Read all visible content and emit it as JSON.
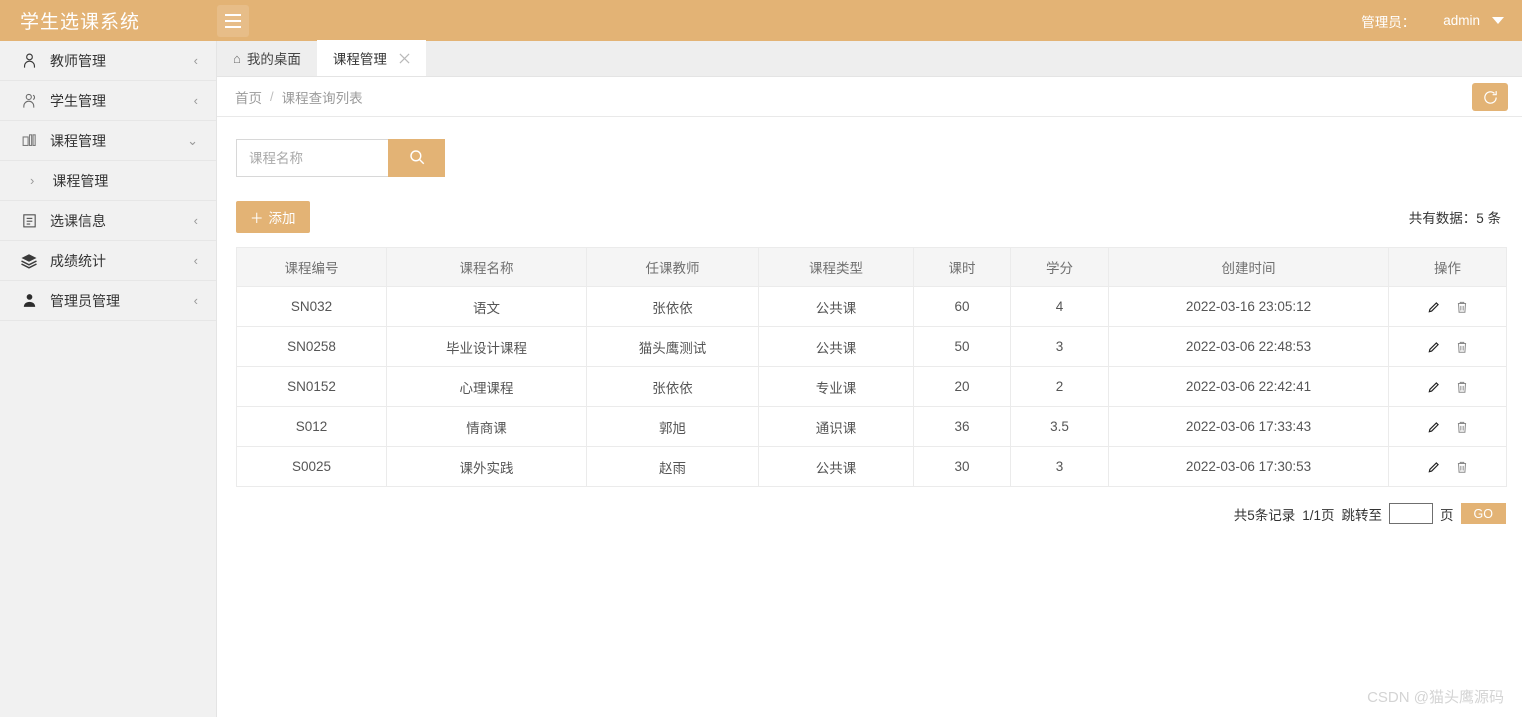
{
  "header": {
    "brand": "学生选课系统",
    "menu_toggle_icon": "hamburger-icon",
    "role_label": "管理员：",
    "username": "admin"
  },
  "sidebar": {
    "items": [
      {
        "label": "教师管理",
        "icon": "user-outline-icon",
        "arrow": "‹",
        "expanded": false
      },
      {
        "label": "学生管理",
        "icon": "users-outline-icon",
        "arrow": "‹",
        "expanded": false
      },
      {
        "label": "课程管理",
        "icon": "books-icon",
        "arrow": "⌄",
        "expanded": true
      },
      {
        "label": "选课信息",
        "icon": "clipboard-icon",
        "arrow": "‹",
        "expanded": false
      },
      {
        "label": "成绩统计",
        "icon": "layers-icon",
        "arrow": "‹",
        "expanded": false
      },
      {
        "label": "管理员管理",
        "icon": "user-solid-icon",
        "arrow": "‹",
        "expanded": false
      }
    ],
    "submenu": {
      "label": "课程管理",
      "arrow": "›"
    }
  },
  "tabs": [
    {
      "label": "我的桌面",
      "icon": "home-icon",
      "active": false,
      "closable": false
    },
    {
      "label": "课程管理",
      "icon": "",
      "active": true,
      "closable": true,
      "close_icon": "close-icon"
    }
  ],
  "breadcrumb": {
    "items": [
      "首页",
      "课程查询列表"
    ],
    "separator": "/",
    "refresh_icon": "refresh-icon"
  },
  "search": {
    "placeholder": "课程名称",
    "value": "",
    "button_icon": "search-icon"
  },
  "toolbar": {
    "add_label": "添加",
    "add_icon": "plus-icon",
    "total_text": "共有数据：5 条"
  },
  "table": {
    "columns": [
      "课程编号",
      "课程名称",
      "任课教师",
      "课程类型",
      "课时",
      "学分",
      "创建时间",
      "操作"
    ],
    "rows": [
      {
        "code": "SN032",
        "name": "语文",
        "teacher": "张依依",
        "type": "公共课",
        "hours": "60",
        "credit": "4",
        "created": "2022-03-16 23:05:12"
      },
      {
        "code": "SN0258",
        "name": "毕业设计课程",
        "teacher": "猫头鹰测试",
        "type": "公共课",
        "hours": "50",
        "credit": "3",
        "created": "2022-03-06 22:48:53"
      },
      {
        "code": "SN0152",
        "name": "心理课程",
        "teacher": "张依依",
        "type": "专业课",
        "hours": "20",
        "credit": "2",
        "created": "2022-03-06 22:42:41"
      },
      {
        "code": "S012",
        "name": "情商课",
        "teacher": "郭旭",
        "type": "通识课",
        "hours": "36",
        "credit": "3.5",
        "created": "2022-03-06 17:33:43"
      },
      {
        "code": "S0025",
        "name": "课外实践",
        "teacher": "赵雨",
        "type": "公共课",
        "hours": "30",
        "credit": "3",
        "created": "2022-03-06 17:30:53"
      }
    ],
    "row_actions": {
      "edit_icon": "pencil-icon",
      "delete_icon": "trash-icon"
    }
  },
  "pagination": {
    "record_text": "共5条记录",
    "page_text": "1/1页",
    "jump_label": "跳转至",
    "jump_value": "",
    "page_unit": "页",
    "go_label": "GO"
  },
  "watermark": "CSDN @猫头鹰源码",
  "colors": {
    "brand": "#e3b375",
    "sidebar_bg": "#f1f1f1",
    "tabbar_bg": "#eeeeee",
    "table_header_bg": "#f5f5f5"
  }
}
